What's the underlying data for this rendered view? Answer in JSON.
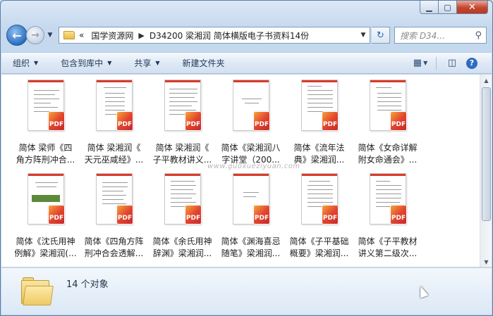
{
  "window": {
    "caption": {
      "minimize": "▁",
      "maximize": "▢",
      "close": "✕"
    }
  },
  "nav": {
    "breadcrumb_prefix": "«",
    "crumbs": [
      "国学资源网",
      "D34200 梁湘润 简体横版电子书资料14份"
    ],
    "search_placeholder": "搜索 D34...",
    "icons": {
      "back": "back-arrow-icon",
      "forward": "forward-arrow-icon",
      "refresh": "refresh-icon",
      "search": "search-icon"
    }
  },
  "toolbar": {
    "organize": "组织",
    "include_library": "包含到库中",
    "share": "共享",
    "new_folder": "新建文件夹"
  },
  "files": [
    {
      "line1": "简体 梁师《四",
      "line2": "角方阵刑冲合..."
    },
    {
      "line1": "简体 梁湘润《",
      "line2": "天元巫咸经》..."
    },
    {
      "line1": "简体 梁湘润《",
      "line2": "子平教材讲义..."
    },
    {
      "line1": "简体《梁湘润八",
      "line2": "字讲堂（200..."
    },
    {
      "line1": "简体《流年法",
      "line2": "典》梁湘润..."
    },
    {
      "line1": "简体《女命详解",
      "line2": "附女命通会》..."
    },
    {
      "line1": "简体《沈氏用神",
      "line2": "例解》梁湘润(..."
    },
    {
      "line1": "简体《四角方阵",
      "line2": "刑冲合会透解..."
    },
    {
      "line1": "简体《余氏用神",
      "line2": "辞渊》梁湘润..."
    },
    {
      "line1": "简体《渊海喜忌",
      "line2": "随笔》梁湘润..."
    },
    {
      "line1": "简体《子平基础",
      "line2": "概要》梁湘润..."
    },
    {
      "line1": "简体《子平教材",
      "line2": "讲义第二级次..."
    }
  ],
  "pdf_badge": "PDF",
  "watermark": "www.guoxueziyuan.com",
  "status": {
    "count": "14 个对象"
  }
}
